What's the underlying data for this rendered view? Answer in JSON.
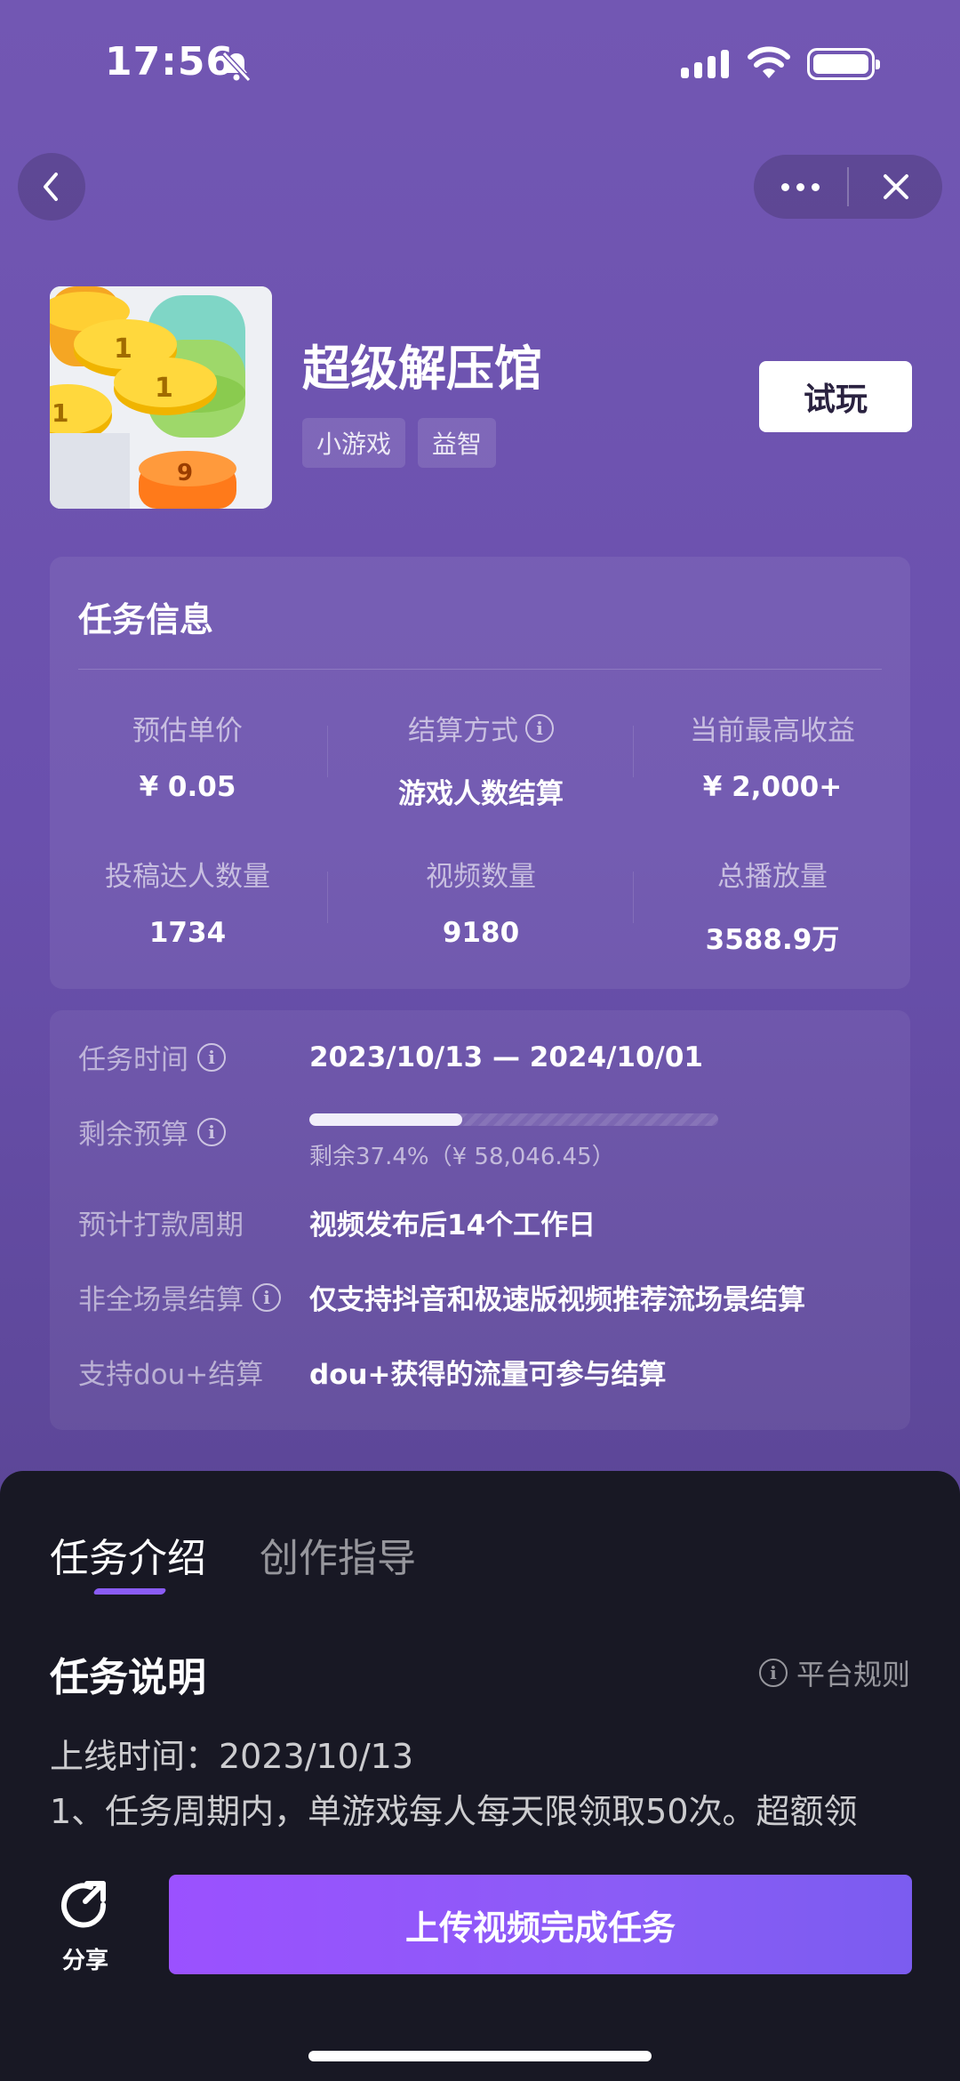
{
  "status": {
    "time": "17:56"
  },
  "game": {
    "title": "超级解压馆",
    "tags": [
      "小游戏",
      "益智"
    ],
    "try_label": "试玩"
  },
  "task_info": {
    "title": "任务信息",
    "stats": [
      {
        "label": "预估单价",
        "value": "¥ 0.05"
      },
      {
        "label": "结算方式",
        "value": "游戏人数结算"
      },
      {
        "label": "当前最高收益",
        "value": "¥ 2,000+"
      },
      {
        "label": "投稿达人数量",
        "value": "1734"
      },
      {
        "label": "视频数量",
        "value": "9180"
      },
      {
        "label": "总播放量",
        "value": "3588.9万"
      }
    ]
  },
  "details": {
    "time_label": "任务时间",
    "time_value": "2023/10/13 — 2024/10/01",
    "budget_label": "剩余预算",
    "budget_remaining_fraction": 0.374,
    "budget_text": "剩余37.4%（¥ 58,046.45）",
    "payment_label": "预计打款周期",
    "payment_value": "视频发布后14个工作日",
    "scene_label": "非全场景结算",
    "scene_value": "仅支持抖音和极速版视频推荐流场景结算",
    "dou_label": "支持dou+结算",
    "dou_value": "dou+获得的流量可参与结算"
  },
  "sheet": {
    "tabs": [
      "任务介绍",
      "创作指导"
    ],
    "section_title": "任务说明",
    "rules_label": "平台规则",
    "line1": "上线时间：2023/10/13",
    "line2": "1、任务周期内，单游戏每人每天限领取50次。超额领"
  },
  "actions": {
    "share_label": "分享",
    "upload_label": "上传视频完成任务"
  }
}
